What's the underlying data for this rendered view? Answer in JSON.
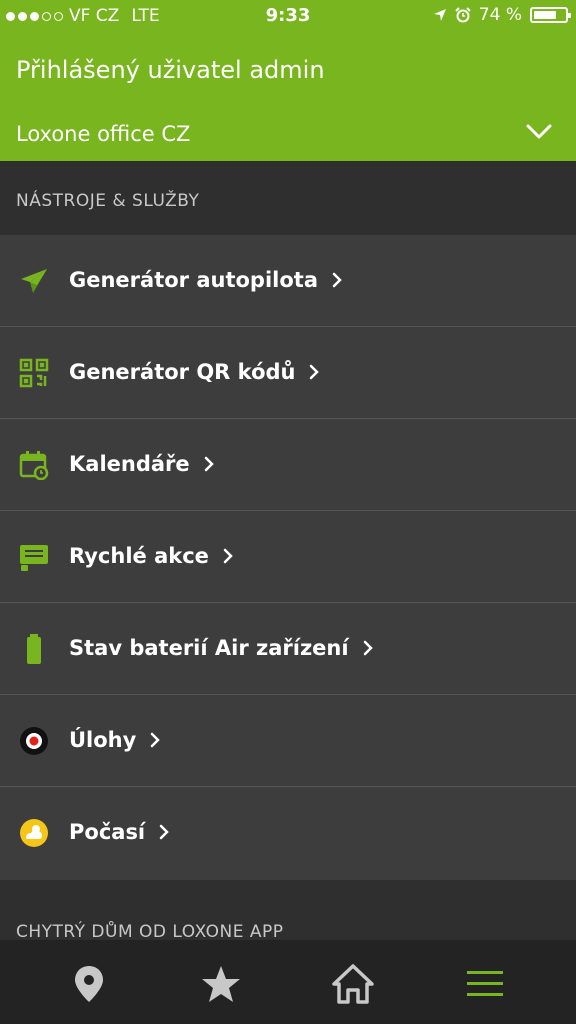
{
  "status_bar": {
    "carrier": "VF CZ",
    "network": "LTE",
    "time": "9:33",
    "battery_percent_text": "74 %",
    "battery_level": 0.74,
    "signal_bars_filled": 3,
    "signal_bars_total": 5
  },
  "header": {
    "user_text": "Přihlášený uživatel admin",
    "location": "Loxone office CZ",
    "chevron_icon": "chevron-down-icon"
  },
  "sections": [
    {
      "title": "NÁSTROJE & SLUŽBY"
    },
    {
      "title": "CHYTRÝ DŮM OD LOXONE APP"
    }
  ],
  "menu": {
    "items": [
      {
        "label": "Generátor autopilota",
        "icon": "paper-plane-icon"
      },
      {
        "label": "Generátor QR kódů",
        "icon": "qr-code-icon"
      },
      {
        "label": "Kalendáře",
        "icon": "calendar-icon"
      },
      {
        "label": "Rychlé akce",
        "icon": "quick-action-icon"
      },
      {
        "label": "Stav baterií Air zařízení",
        "icon": "battery-icon"
      },
      {
        "label": "Úlohy",
        "icon": "record-icon"
      },
      {
        "label": "Počasí",
        "icon": "weather-icon"
      }
    ]
  },
  "tab_bar": {
    "tabs": [
      {
        "icon": "location-pin-icon"
      },
      {
        "icon": "star-icon"
      },
      {
        "icon": "home-icon"
      },
      {
        "icon": "menu-icon",
        "active": true
      }
    ]
  },
  "colors": {
    "accent": "#78b51e",
    "background": "#3d3d3d",
    "section_background": "#2f2f2f",
    "tab_bar_background": "#232323",
    "weather_icon": "#f5c518"
  }
}
